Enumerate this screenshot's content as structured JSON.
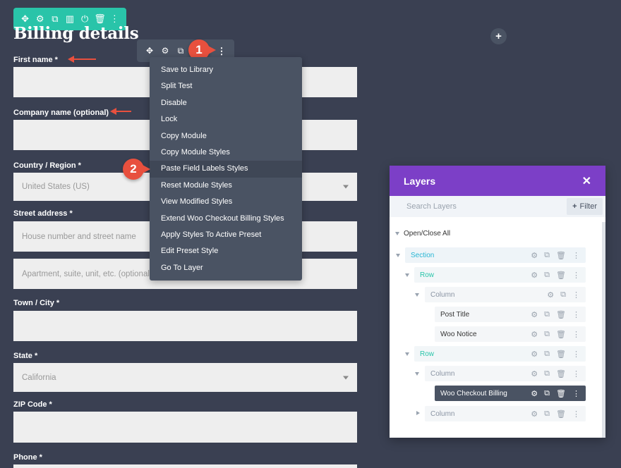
{
  "page": {
    "title": "Billing details"
  },
  "green_toolbar": {
    "icons": [
      "move-icon",
      "gear-icon",
      "duplicate-icon",
      "columns-icon",
      "power-icon",
      "trash-icon",
      "more-icon"
    ],
    "color": "#29c4a9"
  },
  "fields": [
    {
      "label": "First name *",
      "value": ""
    },
    {
      "label": "Company name (optional)",
      "value": ""
    },
    {
      "label": "Country / Region *",
      "value": "United States (US)"
    },
    {
      "label": "Street address *",
      "placeholder1": "House number and street name",
      "placeholder2": "Apartment, suite, unit, etc. (optional)"
    },
    {
      "label": "Town / City *",
      "value": ""
    },
    {
      "label": "State *",
      "value": "California"
    },
    {
      "label": "ZIP Code *",
      "value": ""
    },
    {
      "label": "Phone *",
      "value": ""
    }
  ],
  "module_toolbar": {
    "icons": [
      "move-icon",
      "gear-icon",
      "duplicate-icon",
      "more-icon"
    ]
  },
  "badges": {
    "one": "1",
    "two": "2"
  },
  "context_menu": {
    "items": [
      "Save to Library",
      "Split Test",
      "Disable",
      "Lock",
      "Copy Module",
      "Copy Module Styles",
      "Paste Field Labels Styles",
      "Reset Module Styles",
      "View Modified Styles",
      "Extend Woo Checkout Billing Styles",
      "Apply Styles To Active Preset",
      "Edit Preset Style",
      "Go To Layer"
    ],
    "active_index": 6
  },
  "layers": {
    "title": "Layers",
    "search_placeholder": "Search Layers",
    "filter_label": "Filter",
    "open_close_label": "Open/Close All",
    "header_color": "#7c3fc7",
    "rows": [
      {
        "label": "Section",
        "color": "#29b6d4"
      },
      {
        "label": "Row",
        "color": "#29c4a9"
      },
      {
        "label": "Column",
        "color": "#8a94a3"
      },
      {
        "label": "Post Title",
        "color": "#333333"
      },
      {
        "label": "Woo Notice",
        "color": "#333333"
      },
      {
        "label": "Row",
        "color": "#29c4a9"
      },
      {
        "label": "Column",
        "color": "#8a94a3"
      },
      {
        "label": "Woo Checkout Billing",
        "color": "#ffffff"
      },
      {
        "label": "Column",
        "color": "#8a94a3"
      }
    ]
  }
}
